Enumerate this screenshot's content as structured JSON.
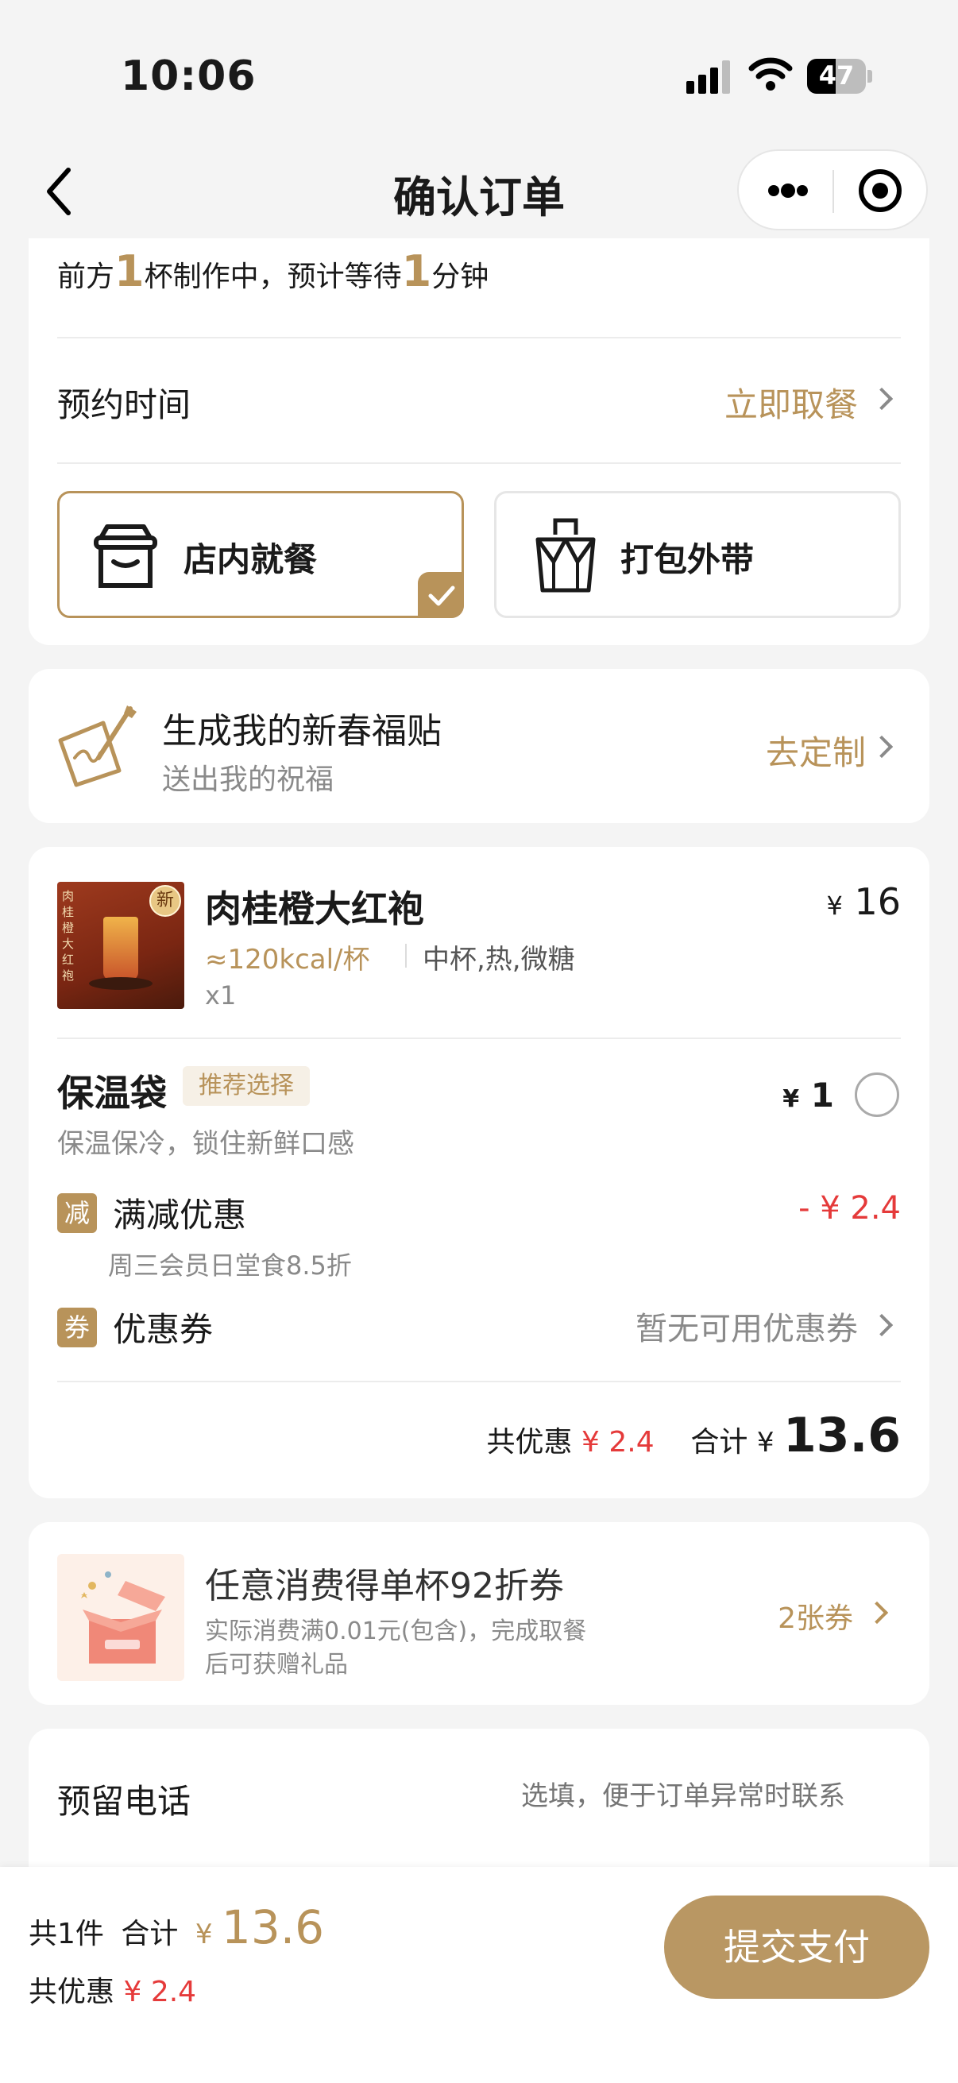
{
  "status": {
    "time": "10:06",
    "battery": "47"
  },
  "nav": {
    "title": "确认订单"
  },
  "queue": {
    "prefix": "前方",
    "cups": "1",
    "middle": "杯制作中，预计等待",
    "minutes": "1",
    "suffix": "分钟"
  },
  "reserve": {
    "label": "预约时间",
    "value": "立即取餐"
  },
  "options": {
    "dinein": "店内就餐",
    "takeout": "打包外带"
  },
  "festival": {
    "title": "生成我的新春福贴",
    "subtitle": "送出我的祝福",
    "action": "去定制"
  },
  "product": {
    "badge": "新",
    "image_text": "肉桂橙大红袍",
    "name": "肉桂橙大红袍",
    "kcal": "≈120kcal/杯",
    "spec": "中杯,热,微糖",
    "qty": "x1",
    "currency": "¥",
    "price": "16"
  },
  "warmbag": {
    "name": "保温袋",
    "tag": "推荐选择",
    "desc": "保温保冷，锁住新鲜口感",
    "currency": "¥",
    "price": "1"
  },
  "discount": {
    "icon": "减",
    "label": "满减优惠",
    "desc": "周三会员日堂食8.5折",
    "amount": "- ¥ 2.4"
  },
  "coupon": {
    "icon": "券",
    "label": "优惠券",
    "value": "暂无可用优惠券"
  },
  "summary": {
    "saved_label": "共优惠",
    "saved": "¥ 2.4",
    "total_label": "合计",
    "currency": "¥",
    "total": "13.6"
  },
  "promo": {
    "title": "任意消费得单杯92折券",
    "line1": "实际消费满0.01元(包含)，完成取餐",
    "line2": "后可获赠礼品",
    "count": "2张券"
  },
  "phone": {
    "label": "预留电话",
    "placeholder": "选填，便于订单异常时联系"
  },
  "bottom": {
    "count": "共1件",
    "total_label": "合计",
    "currency": "¥",
    "total": "13.6",
    "saved_label": "共优惠",
    "saved": "¥ 2.4",
    "pay": "提交支付"
  },
  "colors": {
    "gold": "#b8935a",
    "red": "#e53a3a",
    "button": "#b99763"
  }
}
